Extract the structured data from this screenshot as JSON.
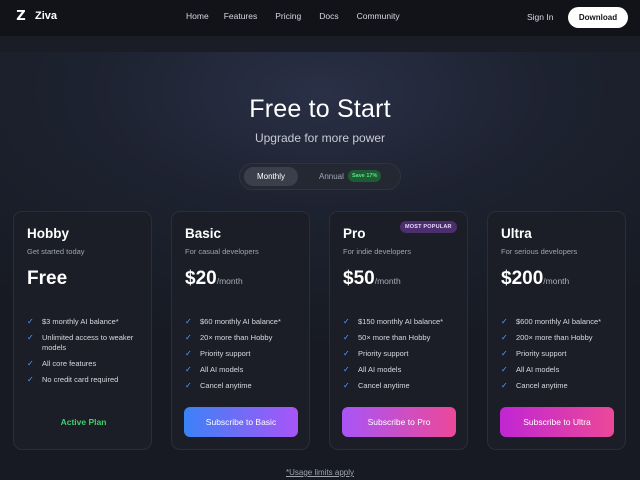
{
  "nav": {
    "brand_mark": "Z",
    "brand_name": "Ziva",
    "links": [
      "Home",
      "Features",
      "Pricing",
      "Docs",
      "Community"
    ],
    "signin": "Sign In",
    "download": "Download"
  },
  "hero": {
    "title": "Free to Start",
    "subtitle": "Upgrade for more power"
  },
  "billing_toggle": {
    "monthly": "Monthly",
    "annual": "Annual",
    "save_badge": "Save 17%",
    "selected": "Monthly"
  },
  "plans": [
    {
      "name": "Hobby",
      "desc": "Get started today",
      "price": "Free",
      "per": "",
      "features": [
        "$3 monthly AI balance*",
        "Unlimited access to weaker models",
        "All core features",
        "No credit card required"
      ],
      "status": "Active Plan"
    },
    {
      "name": "Basic",
      "desc": "For casual developers",
      "price": "$20",
      "per": "/month",
      "features": [
        "$60 monthly AI balance*",
        "20× more than Hobby",
        "Priority support",
        "All AI models",
        "Cancel anytime"
      ],
      "cta": "Subscribe to Basic"
    },
    {
      "name": "Pro",
      "badge": "MOST POPULAR",
      "desc": "For indie developers",
      "price": "$50",
      "per": "/month",
      "features": [
        "$150 monthly AI balance*",
        "50× more than Hobby",
        "Priority support",
        "All AI models",
        "Cancel anytime"
      ],
      "cta": "Subscribe to Pro"
    },
    {
      "name": "Ultra",
      "desc": "For serious developers",
      "price": "$200",
      "per": "/month",
      "features": [
        "$600 monthly AI balance*",
        "200× more than Hobby",
        "Priority support",
        "All AI models",
        "Cancel anytime"
      ],
      "cta": "Subscribe to Ultra"
    }
  ],
  "footnote": "*Usage limits apply",
  "icons": {
    "feature_check": "check-icon"
  },
  "colors": {
    "check": "#5aa0ff",
    "active": "#3fcf6d",
    "save_badge": "#5fe08a"
  }
}
